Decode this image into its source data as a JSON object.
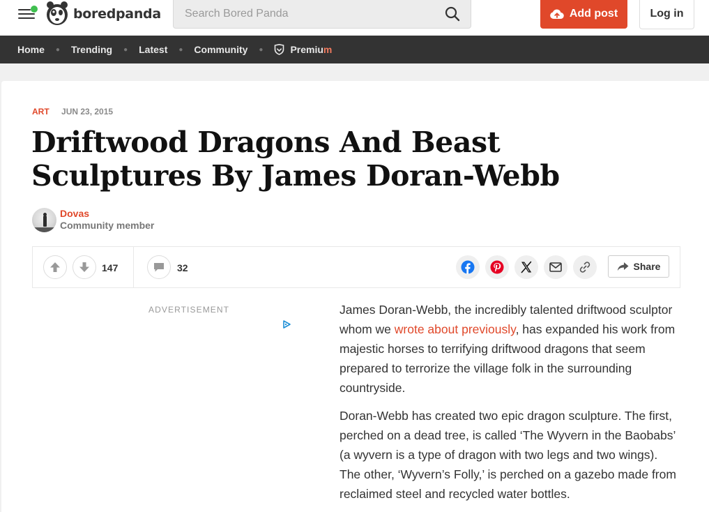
{
  "header": {
    "logo_text": "boredpanda",
    "search_placeholder": "Search Bored Panda",
    "add_post_label": "Add post",
    "login_label": "Log in",
    "notification_dot_color": "#3fbf4f",
    "accent_color": "#e0482a"
  },
  "nav": {
    "items": [
      "Home",
      "Trending",
      "Latest",
      "Community"
    ],
    "premium_pre": "Premiu",
    "premium_post": "m"
  },
  "article": {
    "category": "ART",
    "date": "JUN 23, 2015",
    "title": "Driftwood Dragons And Beast Sculptures By James Doran-Webb",
    "author_name": "Dovas",
    "author_role": "Community member",
    "upvotes": "147",
    "comments": "32",
    "share_label": "Share",
    "ad_label": "ADVERTISEMENT",
    "paragraphs": [
      {
        "before": "James Doran-Webb, the incredibly talented driftwood sculptor whom we ",
        "link": "wrote about previously",
        "after": ", has expanded his work from majestic horses to terrifying driftwood dragons that seem prepared to terrorize the village folk in the surrounding countryside."
      },
      {
        "text": "Doran-Webb has created two epic dragon sculpture. The first, perched on a dead tree, is called ‘The Wyvern in the Baobabs’ (a wyvern is a type of dragon with two legs and two wings). The other, ‘Wyvern’s Folly,’ is perched on a gazebo made from reclaimed steel and recycled water bottles."
      }
    ]
  },
  "icons": {
    "menu": "hamburger-menu-icon",
    "search": "search-icon",
    "upload": "cloud-upload-icon",
    "premium": "shield-icon",
    "upvote": "arrow-up-icon",
    "downvote": "arrow-down-icon",
    "comment": "comment-bubble-icon",
    "facebook": "facebook-icon",
    "pinterest": "pinterest-icon",
    "x": "x-twitter-icon",
    "email": "email-icon",
    "link": "link-icon",
    "share": "share-arrow-icon",
    "ad": "ad-choices-icon"
  }
}
